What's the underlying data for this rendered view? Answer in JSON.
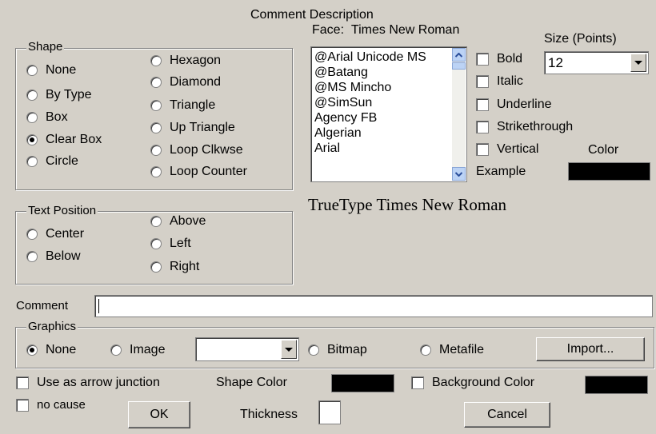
{
  "title": "Comment Description",
  "shape": {
    "legend": "Shape",
    "options_left": [
      "None",
      "By Type",
      "Box",
      "Clear Box",
      "Circle"
    ],
    "options_right": [
      "Hexagon",
      "Diamond",
      "Triangle",
      "Up Triangle",
      "Loop Clkwse",
      "Loop Counter"
    ],
    "selected": "Clear Box"
  },
  "face": {
    "label": "Face:",
    "value": "Times New Roman",
    "fonts": [
      "@Arial Unicode MS",
      "@Batang",
      "@MS Mincho",
      "@SimSun",
      "Agency FB",
      "Algerian",
      "Arial"
    ]
  },
  "size": {
    "label": "Size (Points)",
    "value": "12"
  },
  "styles": {
    "bold": "Bold",
    "italic": "Italic",
    "underline": "Underline",
    "strikethrough": "Strikethrough",
    "vertical": "Vertical"
  },
  "color_label": "Color",
  "example_label": "Example",
  "preview_text": "TrueType Times New Roman",
  "text_position": {
    "legend": "Text Position",
    "options_left": [
      "Center",
      "Below"
    ],
    "options_right": [
      "Above",
      "Left",
      "Right"
    ]
  },
  "comment": {
    "label": "Comment",
    "value": ""
  },
  "graphics": {
    "legend": "Graphics",
    "none": "None",
    "image": "Image",
    "image_select_value": "",
    "bitmap": "Bitmap",
    "metafile": "Metafile",
    "import": "Import...",
    "selected": "None"
  },
  "footer": {
    "arrow_junction": "Use as arrow junction",
    "no_cause": "no cause",
    "ok": "OK",
    "shape_color": "Shape Color",
    "thickness": "Thickness",
    "thickness_value": "",
    "background_color": "Background Color",
    "cancel": "Cancel"
  },
  "colors": {
    "dialog_bg": "#d4d0c8",
    "swatch": "#000000",
    "scroll_accent": "#bcd3f5"
  }
}
